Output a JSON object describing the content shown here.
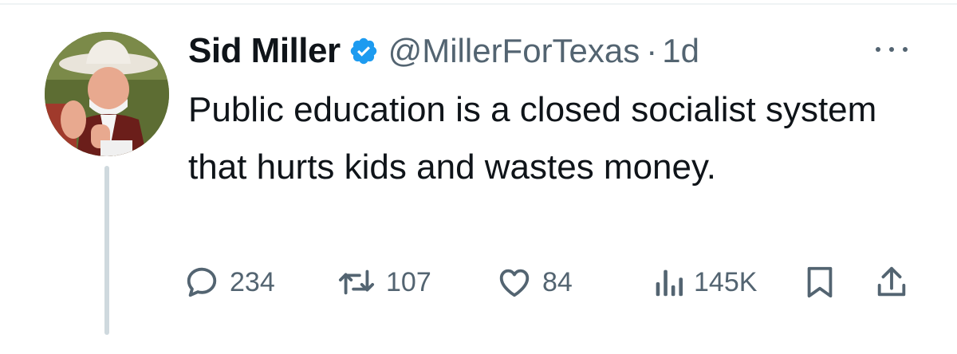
{
  "tweet": {
    "author_name": "Sid Miller",
    "handle": "@MillerForTexas",
    "separator": "·",
    "timestamp": "1d",
    "verified": true,
    "text": "Public education is a closed socialist system that hurts kids and wastes money."
  },
  "metrics": {
    "replies": "234",
    "retweets": "107",
    "likes": "84",
    "views": "145K"
  },
  "icons": {
    "reply": "reply-icon",
    "retweet": "retweet-icon",
    "like": "heart-icon",
    "views": "views-icon",
    "bookmark": "bookmark-icon",
    "share": "share-icon",
    "more": "more-icon",
    "verified": "verified-badge-icon"
  },
  "colors": {
    "text": "#0f1419",
    "secondary": "#536471",
    "verified": "#1d9bf0",
    "thread_line": "#cfd9de"
  }
}
